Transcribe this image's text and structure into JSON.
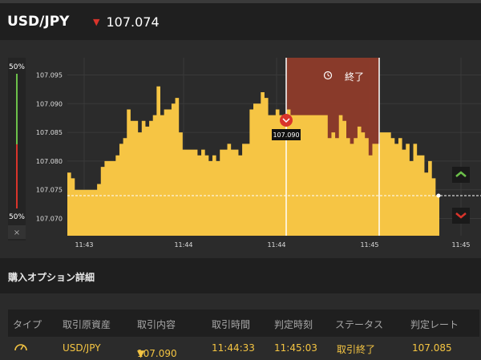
{
  "header": {
    "pair": "USD/JPY",
    "rate": "107.074",
    "rate_direction_icon": "down-arrow-icon"
  },
  "chart": {
    "sentiment_top": "50%",
    "sentiment_bottom": "50%",
    "close_button": "×",
    "expired_label": "終了",
    "entry_tooltip": "107.090",
    "current_rate": "107.074",
    "colors": {
      "area": "#f6c544",
      "expired_zone": "#8e3b2a",
      "up": "#6cc04a",
      "down": "#d9342b"
    }
  },
  "chart_data": {
    "type": "area",
    "x_tick_labels": [
      "11:43",
      "11:44",
      "11:44",
      "11:45",
      "11:45"
    ],
    "y_tick_labels": [
      "107.095",
      "107.090",
      "107.085",
      "107.080",
      "107.075",
      "107.070"
    ],
    "ylim": [
      107.067,
      107.098
    ],
    "xlim": [
      0,
      100
    ],
    "series": [
      {
        "x": [
          0,
          1,
          2,
          5,
          8,
          9,
          10,
          11,
          12,
          13,
          14,
          15,
          16,
          17,
          18,
          19,
          20,
          21,
          22,
          23,
          24,
          25,
          26,
          27,
          28,
          29,
          30,
          31,
          32,
          33,
          34,
          35,
          36,
          37,
          38,
          39,
          40,
          41,
          42,
          43,
          44,
          45,
          46,
          47,
          48,
          49,
          50,
          51,
          52,
          53,
          54,
          55,
          56,
          57,
          58,
          59,
          60,
          61,
          62,
          63,
          64,
          65,
          66,
          67,
          68,
          69,
          70,
          71,
          72,
          73,
          74,
          75,
          76,
          77,
          78,
          79,
          80,
          81,
          82,
          83,
          84,
          85,
          86,
          87,
          88,
          89,
          90,
          91,
          92,
          93,
          94,
          95,
          96,
          97,
          98,
          99,
          100
        ],
        "values": [
          107.078,
          107.077,
          107.075,
          107.075,
          107.076,
          107.079,
          107.08,
          107.08,
          107.08,
          107.081,
          107.083,
          107.084,
          107.089,
          107.087,
          107.087,
          107.085,
          107.087,
          107.086,
          107.087,
          107.088,
          107.093,
          107.088,
          107.089,
          107.089,
          107.09,
          107.091,
          107.085,
          107.082,
          107.082,
          107.082,
          107.082,
          107.081,
          107.082,
          107.081,
          107.08,
          107.081,
          107.08,
          107.082,
          107.082,
          107.083,
          107.082,
          107.082,
          107.081,
          107.083,
          107.083,
          107.089,
          107.09,
          107.09,
          107.092,
          107.091,
          107.088,
          107.088,
          107.089,
          107.088,
          107.088,
          107.089,
          107.088,
          107.088,
          107.088,
          107.088,
          107.088,
          107.088,
          107.088,
          107.088,
          107.088,
          107.088,
          107.084,
          107.085,
          107.084,
          107.088,
          107.087,
          107.084,
          107.083,
          107.084,
          107.086,
          107.085,
          107.084,
          107.081,
          107.083,
          107.083,
          107.085,
          107.085,
          107.085,
          107.084,
          107.083,
          107.084,
          107.082,
          107.083,
          107.08,
          107.083,
          107.081,
          107.081,
          107.078,
          107.08,
          107.077,
          107.074,
          107.074
        ]
      }
    ],
    "entry_value": 107.09,
    "current_value": 107.074
  },
  "section": {
    "title": "購入オプション詳細"
  },
  "table": {
    "headers": [
      "タイプ",
      "取引原資産",
      "取引内容",
      "取引時間",
      "判定時刻",
      "ステータス",
      "判定レート"
    ],
    "row": {
      "type_icon": "gauge-icon",
      "asset": "USD/JPY",
      "content": "107.090",
      "trade_time": "11:44:33",
      "judge_time": "11:45:03",
      "status": "取引終了",
      "judge_rate": "107.085"
    }
  }
}
